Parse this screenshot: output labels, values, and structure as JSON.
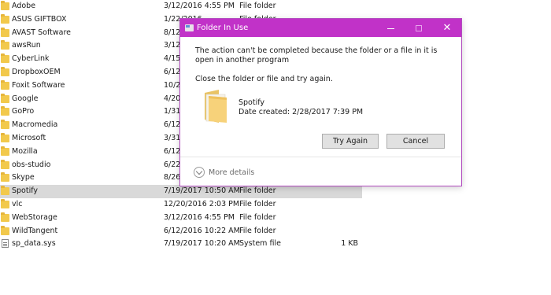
{
  "files": [
    {
      "name": "Adobe",
      "date": "3/12/2016 4:55 PM",
      "type": "File folder",
      "size": "",
      "icon": "folder-icon"
    },
    {
      "name": "ASUS GIFTBOX",
      "date": "1/22/2016",
      "type": "File folder",
      "size": "",
      "icon": "folder-icon"
    },
    {
      "name": "AVAST Software",
      "date": "8/12",
      "type": "",
      "size": "",
      "icon": "folder-icon"
    },
    {
      "name": "awsRun",
      "date": "3/12",
      "type": "",
      "size": "",
      "icon": "folder-icon"
    },
    {
      "name": "CyberLink",
      "date": "4/15",
      "type": "",
      "size": "",
      "icon": "folder-icon"
    },
    {
      "name": "DropboxOEM",
      "date": "6/12",
      "type": "",
      "size": "",
      "icon": "folder-icon"
    },
    {
      "name": "Foxit Software",
      "date": "10/2",
      "type": "",
      "size": "",
      "icon": "folder-icon"
    },
    {
      "name": "Google",
      "date": "4/20",
      "type": "",
      "size": "",
      "icon": "folder-icon"
    },
    {
      "name": "GoPro",
      "date": "1/31",
      "type": "",
      "size": "",
      "icon": "folder-icon"
    },
    {
      "name": "Macromedia",
      "date": "6/12",
      "type": "",
      "size": "",
      "icon": "folder-icon"
    },
    {
      "name": "Microsoft",
      "date": "3/31",
      "type": "",
      "size": "",
      "icon": "folder-icon"
    },
    {
      "name": "Mozilla",
      "date": "6/12",
      "type": "",
      "size": "",
      "icon": "folder-icon"
    },
    {
      "name": "obs-studio",
      "date": "6/22",
      "type": "",
      "size": "",
      "icon": "folder-icon"
    },
    {
      "name": "Skype",
      "date": "8/26",
      "type": "",
      "size": "",
      "icon": "folder-icon"
    },
    {
      "name": "Spotify",
      "date": "7/19/2017 10:50 AM",
      "type": "File folder",
      "size": "",
      "icon": "folder-icon",
      "selected": true
    },
    {
      "name": "vlc",
      "date": "12/20/2016 2:03 PM",
      "type": "File folder",
      "size": "",
      "icon": "folder-icon"
    },
    {
      "name": "WebStorage",
      "date": "3/12/2016 4:55 PM",
      "type": "File folder",
      "size": "",
      "icon": "folder-icon"
    },
    {
      "name": "WildTangent",
      "date": "6/12/2016 10:22 AM",
      "type": "File folder",
      "size": "",
      "icon": "folder-icon"
    },
    {
      "name": "sp_data.sys",
      "date": "7/19/2017 10:20 AM",
      "type": "System file",
      "size": "1 KB",
      "icon": "system-file-icon"
    }
  ],
  "dialog": {
    "title": "Folder In Use",
    "message": "The action can't be completed because the folder or a file in it is open in another program",
    "instruction": "Close the folder or file and try again.",
    "item_name": "Spotify",
    "date_label": "Date created:",
    "date_value": "2/28/2017 7:39 PM",
    "try_again_label": "Try Again",
    "cancel_label": "Cancel",
    "more_details_label": "More details",
    "close_glyph": "✕",
    "titlebar_color": "#c132c8"
  }
}
